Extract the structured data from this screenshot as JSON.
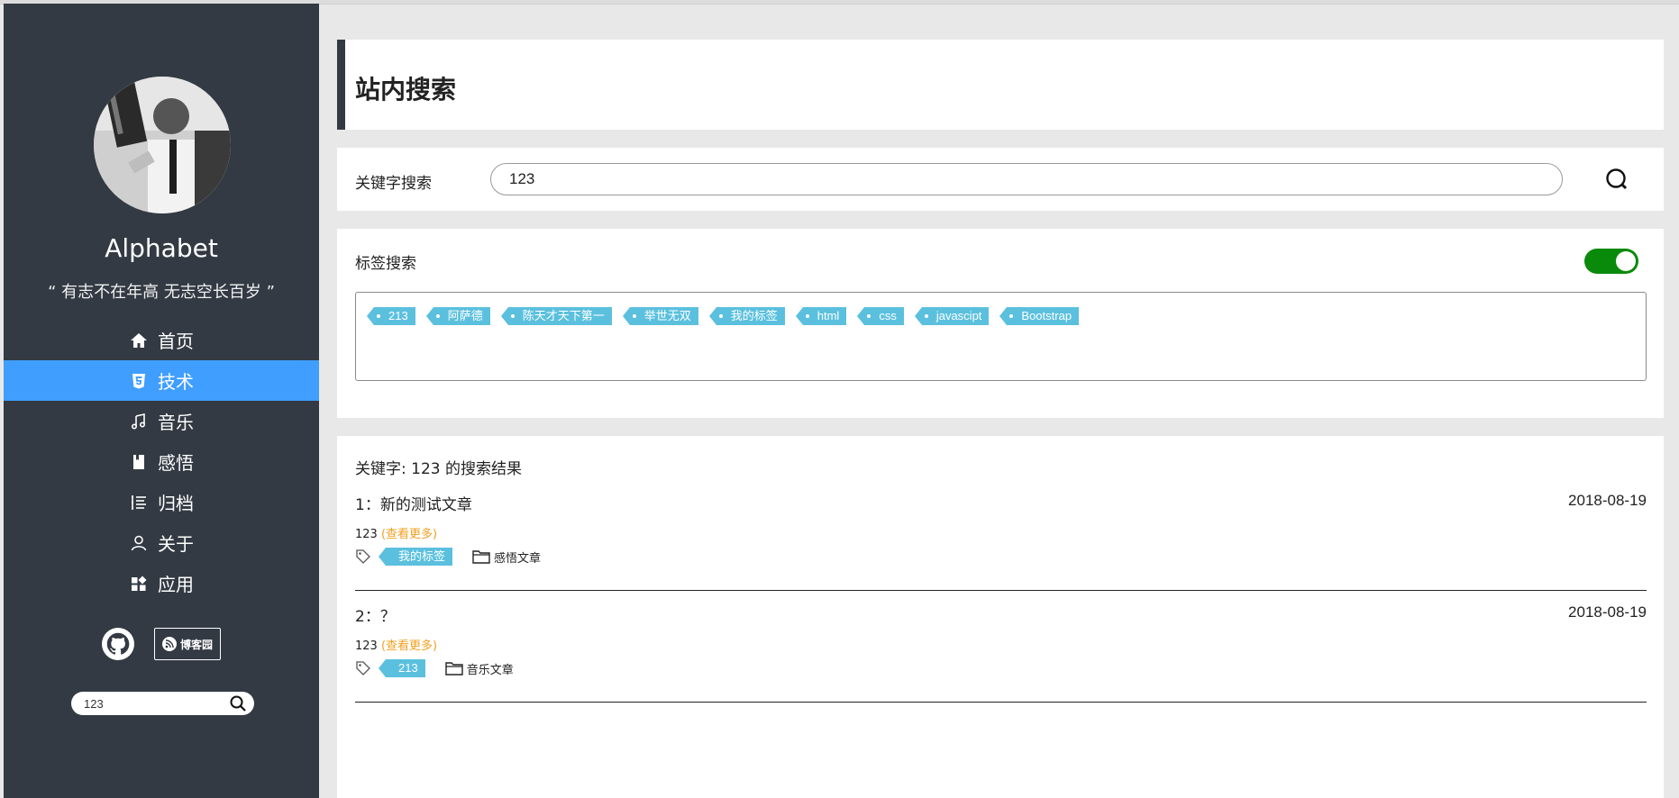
{
  "sidebar": {
    "site_name": "Alphabet",
    "motto": "“ 有志不在年高 无志空长百岁 ”",
    "nav": [
      {
        "label": "首页",
        "icon": "home-icon"
      },
      {
        "label": "技术",
        "icon": "html5-icon",
        "active": true
      },
      {
        "label": "音乐",
        "icon": "music-note-icon"
      },
      {
        "label": "感悟",
        "icon": "bookmark-icon"
      },
      {
        "label": "归档",
        "icon": "list-icon"
      },
      {
        "label": "关于",
        "icon": "user-icon"
      },
      {
        "label": "应用",
        "icon": "apps-icon"
      }
    ],
    "cnblogs_label": "博客园",
    "search_value": "123"
  },
  "page": {
    "title": "站内搜索"
  },
  "keyword_search": {
    "label": "关键字搜索",
    "value": "123"
  },
  "tag_search": {
    "label": "标签搜索",
    "toggle_on": true,
    "tags": [
      "213",
      "阿萨德",
      "陈天才天下第一",
      "举世无双",
      "我的标签",
      "html",
      "css",
      "javascipt",
      "Bootstrap"
    ]
  },
  "results": {
    "heading": "关键字: 123 的搜索结果",
    "items": [
      {
        "title": "1：新的测试文章",
        "date": "2018-08-19",
        "excerpt": "123",
        "more": "(查看更多)",
        "tag": "我的标签",
        "category": "感悟文章"
      },
      {
        "title": "2：？",
        "date": "2018-08-19",
        "excerpt": "123",
        "more": "(查看更多)",
        "tag": "213",
        "category": "音乐文章"
      }
    ]
  },
  "colors": {
    "sidebar_bg": "#333a43",
    "active_nav": "#409eff",
    "tag_bg": "#5bc0de",
    "toggle_on": "#0a8a0a",
    "more_link": "#f0a020"
  }
}
